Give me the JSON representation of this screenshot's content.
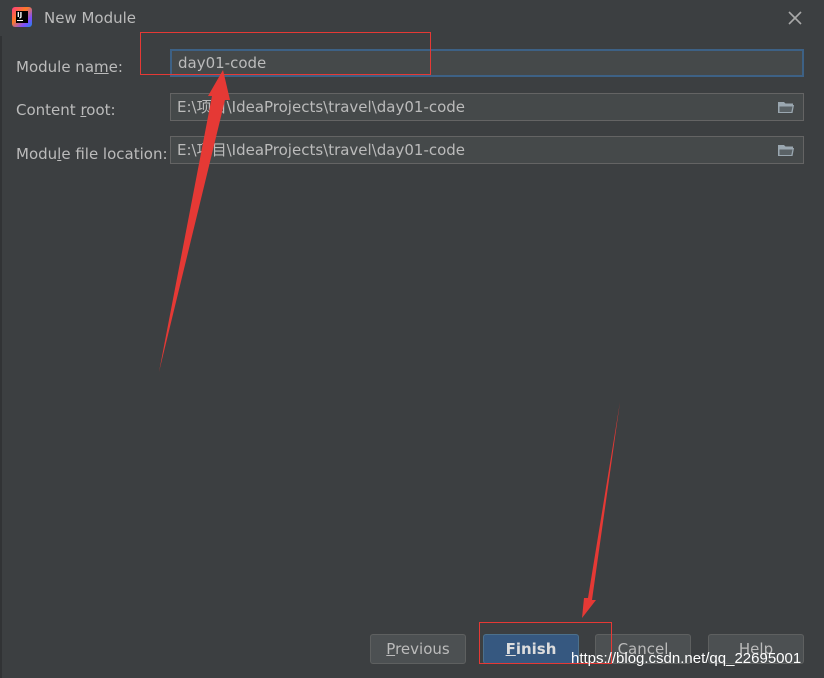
{
  "window": {
    "title": "New Module"
  },
  "fields": [
    {
      "label_pre": "Module na",
      "label_mnemonic": "m",
      "label_post": "e:",
      "value": "day01-code"
    },
    {
      "label_pre": "Content ",
      "label_mnemonic": "r",
      "label_post": "oot:",
      "value": "E:\\项目\\IdeaProjects\\travel\\day01-code"
    },
    {
      "label_pre": "Modu",
      "label_mnemonic": "l",
      "label_post": "e file location:",
      "value": "E:\\项目\\IdeaProjects\\travel\\day01-code"
    }
  ],
  "buttons": {
    "previous": {
      "mnemonic": "P",
      "rest": "revious"
    },
    "finish": {
      "mnemonic": "F",
      "rest": "inish"
    },
    "cancel": {
      "label": "Cancel"
    },
    "help": {
      "label": "Help"
    }
  },
  "watermark": "https://blog.csdn.net/qq_22695001",
  "colors": {
    "annotation": "#e53935",
    "focus_border": "#3d6185",
    "primary_button": "#365880"
  }
}
